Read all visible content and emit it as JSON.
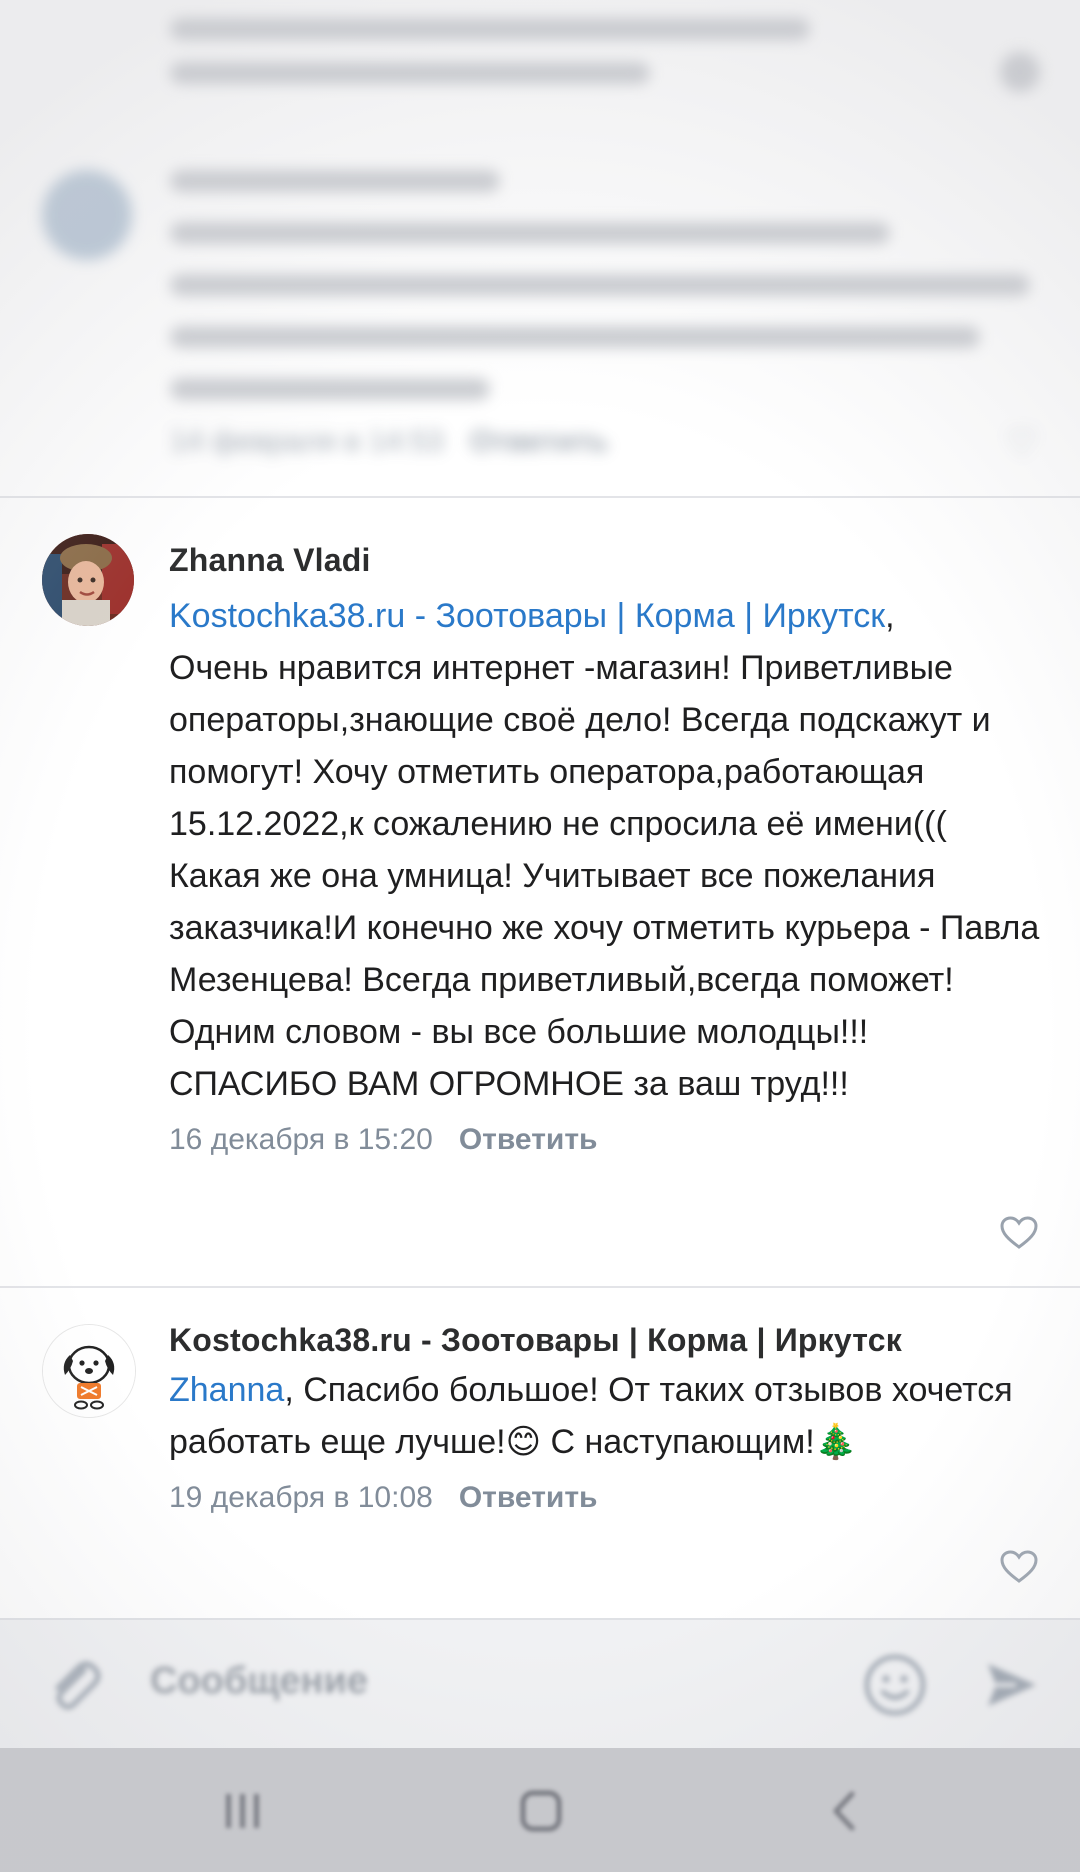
{
  "previous_comment": {
    "date": "14 февраля в 14:53",
    "reply_label": "Ответить"
  },
  "comments": [
    {
      "author": "Zhanna Vladi",
      "mention": "Kostochka38.ru - Зоотовары | Корма | Иркутск",
      "mention_suffix": ",",
      "text": "Очень нравится интернет -магазин! Приветливые операторы,знающие своё дело! Всегда подскажут и помогут! Хочу отметить оператора,работающая 15.12.2022,к сожалению не спросила её имени((( Какая же она умница! Учитывает все пожелания заказчика!И конечно же хочу отметить курьера - Павла Мезенцева! Всегда приветливый,всегда поможет! Одним словом - вы все большие молодцы!!! СПАСИБО ВАМ ОГРОМНОЕ за ваш труд!!!",
      "date": "16 декабря в 15:20",
      "reply_label": "Ответить",
      "avatar_icon": "user-photo"
    },
    {
      "author": "Kostochka38.ru - Зоотовары | Корма | Иркутск",
      "mention": "Zhanna",
      "text_part1": ", Спасибо большое! От таких отзывов хочется работать еще лучше!",
      "emoji1": "😊",
      "text_part2": " С наступающим!",
      "emoji2": "🎄",
      "date": "19 декабря в 10:08",
      "reply_label": "Ответить",
      "avatar_icon": "dog-logo"
    }
  ],
  "composer": {
    "placeholder": "Сообщение",
    "attach_icon": "paperclip-icon",
    "emoji_icon": "smile-icon",
    "send_icon": "send-icon"
  },
  "navbar": {
    "recent_icon": "recent-apps-icon",
    "home_icon": "home-icon",
    "back_icon": "back-icon"
  },
  "colors": {
    "link": "#2a79c9",
    "meta": "#818c99",
    "text": "#1f1f20"
  }
}
